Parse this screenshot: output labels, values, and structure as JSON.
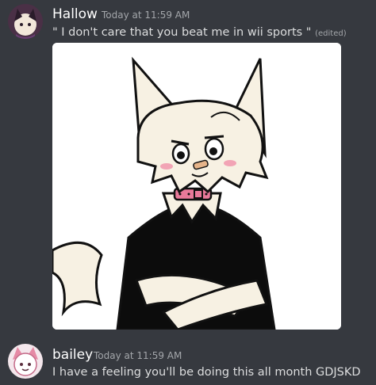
{
  "messages": [
    {
      "author": "Hallow",
      "timestamp": "Today at 11:59 AM",
      "content": "\" I don't care that you beat me in wii sports \"",
      "edited_label": "(edited)",
      "attachment": "drawing"
    },
    {
      "author": "bailey",
      "timestamp": "Today at 11:59 AM",
      "content": "I have a feeling you'll be doing this all month GDJSKD"
    }
  ],
  "colors": {
    "background": "#36393f",
    "username": "#ffffff",
    "timestamp": "#a3a6aa",
    "text": "#dcddde",
    "collar": "#e8799a"
  }
}
